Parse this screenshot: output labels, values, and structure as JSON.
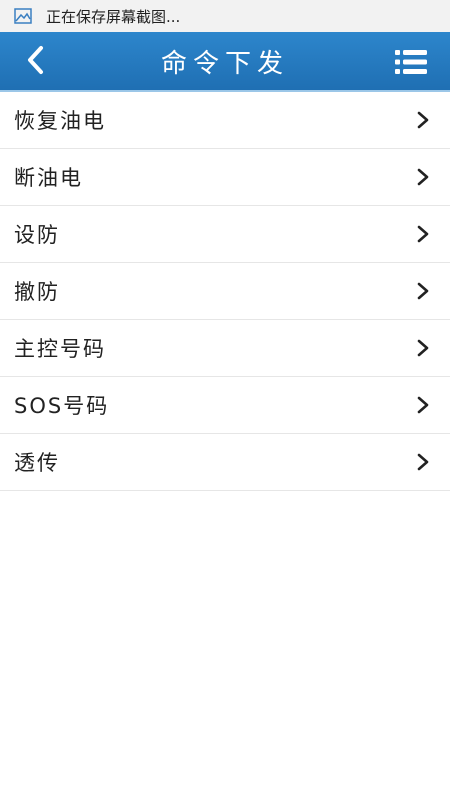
{
  "status_bar": {
    "icon": "image-icon",
    "text": "正在保存屏幕截图..."
  },
  "header": {
    "title": "命令下发",
    "back_icon": "chevron-left-icon",
    "menu_icon": "list-menu-icon",
    "background": "#1f6fb3"
  },
  "commands": [
    {
      "label": "恢复油电"
    },
    {
      "label": "断油电"
    },
    {
      "label": "设防"
    },
    {
      "label": "撤防"
    },
    {
      "label": "主控号码"
    },
    {
      "label": "SOS号码"
    },
    {
      "label": "透传"
    }
  ]
}
